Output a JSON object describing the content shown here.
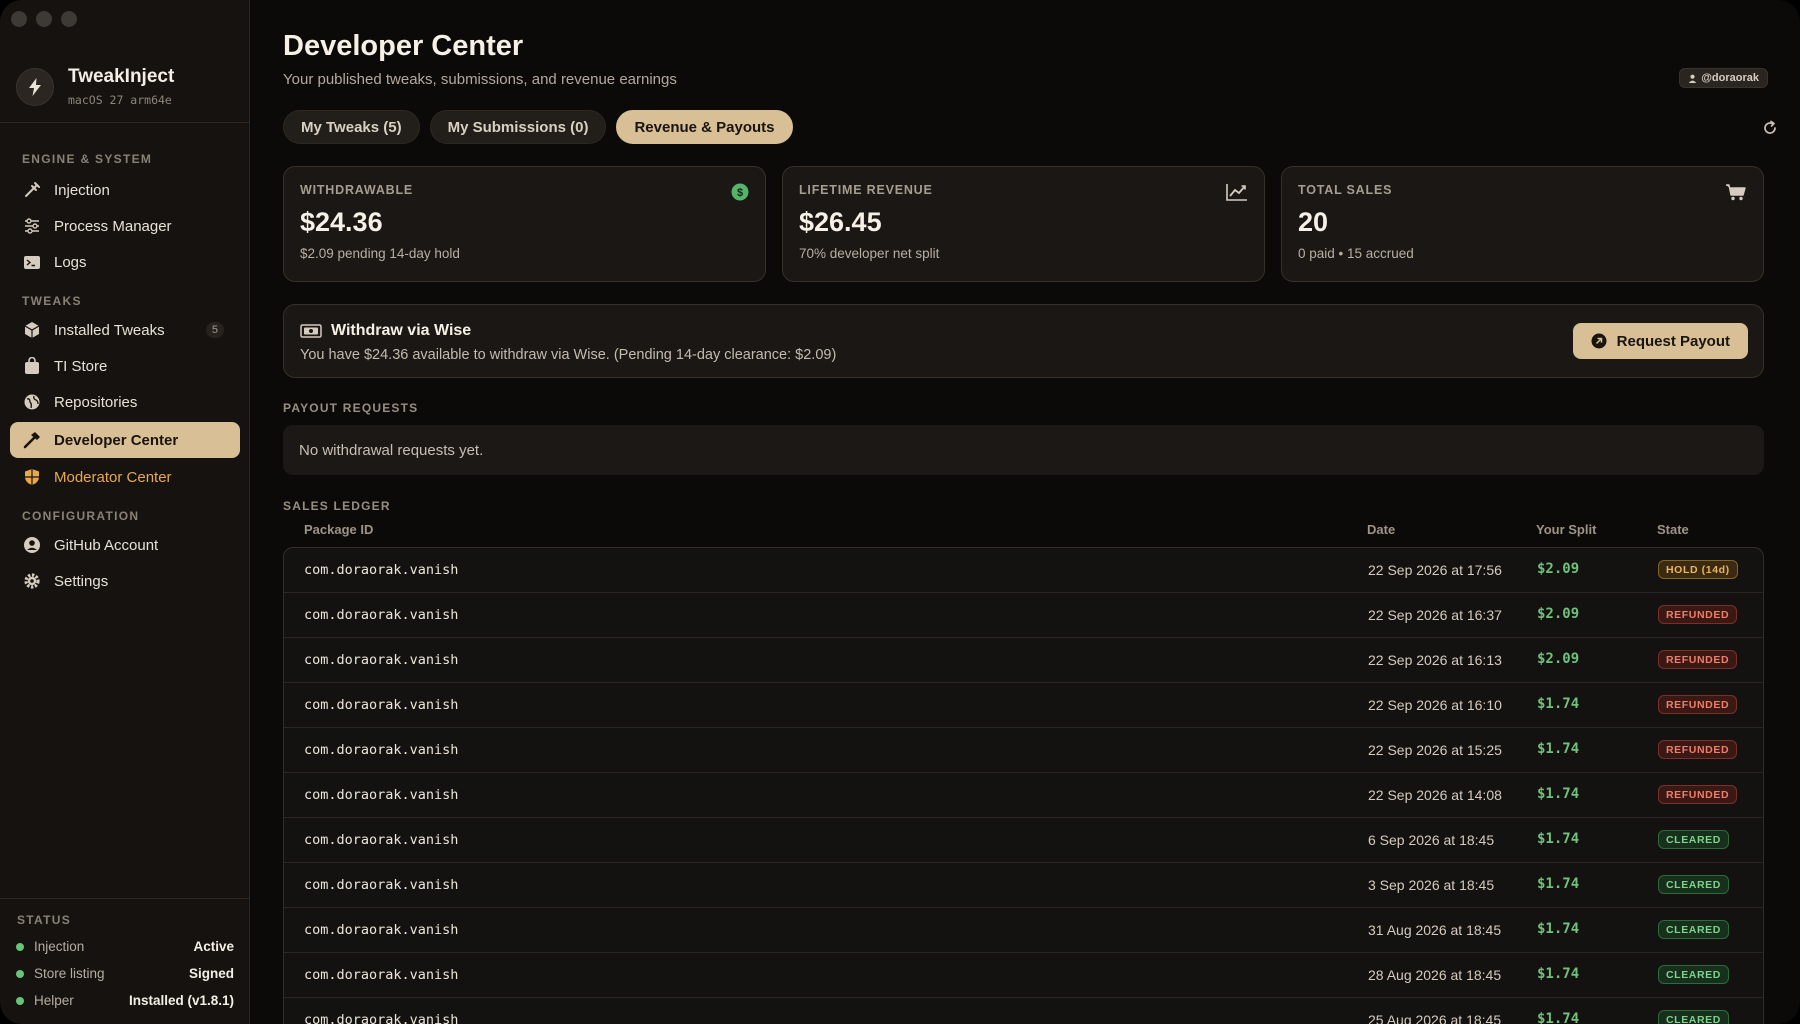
{
  "brand": {
    "name": "TweakInject",
    "subtitle": "macOS 27 arm64e"
  },
  "sidebar": {
    "sections": {
      "engine": "ENGINE & SYSTEM",
      "tweaks": "TWEAKS",
      "configuration": "CONFIGURATION",
      "status": "STATUS"
    },
    "items": {
      "injection": "Injection",
      "process_manager": "Process Manager",
      "logs": "Logs",
      "installed_tweaks": "Installed Tweaks",
      "installed_tweaks_count": "5",
      "ti_store": "TI Store",
      "repositories": "Repositories",
      "developer_center": "Developer Center",
      "moderator_center": "Moderator Center",
      "github_account": "GitHub Account",
      "settings": "Settings"
    },
    "status": [
      {
        "key": "Injection",
        "value": "Active"
      },
      {
        "key": "Store listing",
        "value": "Signed"
      },
      {
        "key": "Helper",
        "value": "Installed (v1.8.1)"
      }
    ]
  },
  "header": {
    "title": "Developer Center",
    "subtitle": "Your published tweaks, submissions, and revenue earnings",
    "user": "@doraorak"
  },
  "tabs": [
    "My Tweaks (5)",
    "My Submissions (0)",
    "Revenue & Payouts"
  ],
  "cards": {
    "withdrawable": {
      "label": "WITHDRAWABLE",
      "value": "$24.36",
      "note": "$2.09 pending 14-day hold",
      "icon_glyph": "$"
    },
    "lifetime": {
      "label": "LIFETIME REVENUE",
      "value": "$26.45",
      "note": "70% developer net split"
    },
    "sales": {
      "label": "TOTAL SALES",
      "value": "20",
      "note": "0 paid • 15 accrued"
    }
  },
  "withdraw": {
    "title": "Withdraw via Wise",
    "text": "You have $24.36 available to withdraw via Wise. (Pending 14-day clearance: $2.09)",
    "button": "Request Payout"
  },
  "payouts": {
    "title": "PAYOUT REQUESTS",
    "empty": "No withdrawal requests yet."
  },
  "ledger": {
    "title": "SALES LEDGER",
    "columns": [
      "Package ID",
      "Date",
      "Your Split",
      "State"
    ],
    "rows": [
      {
        "pkg": "com.doraorak.vanish",
        "date": "22 Sep 2026 at 17:56",
        "split": "$2.09",
        "state": "HOLD (14d)",
        "kind": "hold"
      },
      {
        "pkg": "com.doraorak.vanish",
        "date": "22 Sep 2026 at 16:37",
        "split": "$2.09",
        "state": "REFUNDED",
        "kind": "refunded"
      },
      {
        "pkg": "com.doraorak.vanish",
        "date": "22 Sep 2026 at 16:13",
        "split": "$2.09",
        "state": "REFUNDED",
        "kind": "refunded"
      },
      {
        "pkg": "com.doraorak.vanish",
        "date": "22 Sep 2026 at 16:10",
        "split": "$1.74",
        "state": "REFUNDED",
        "kind": "refunded"
      },
      {
        "pkg": "com.doraorak.vanish",
        "date": "22 Sep 2026 at 15:25",
        "split": "$1.74",
        "state": "REFUNDED",
        "kind": "refunded"
      },
      {
        "pkg": "com.doraorak.vanish",
        "date": "22 Sep 2026 at 14:08",
        "split": "$1.74",
        "state": "REFUNDED",
        "kind": "refunded"
      },
      {
        "pkg": "com.doraorak.vanish",
        "date": "6 Sep 2026 at 18:45",
        "split": "$1.74",
        "state": "CLEARED",
        "kind": "cleared"
      },
      {
        "pkg": "com.doraorak.vanish",
        "date": "3 Sep 2026 at 18:45",
        "split": "$1.74",
        "state": "CLEARED",
        "kind": "cleared"
      },
      {
        "pkg": "com.doraorak.vanish",
        "date": "31 Aug 2026 at 18:45",
        "split": "$1.74",
        "state": "CLEARED",
        "kind": "cleared"
      },
      {
        "pkg": "com.doraorak.vanish",
        "date": "28 Aug 2026 at 18:45",
        "split": "$1.74",
        "state": "CLEARED",
        "kind": "cleared"
      },
      {
        "pkg": "com.doraorak.vanish",
        "date": "25 Aug 2026 at 18:45",
        "split": "$1.74",
        "state": "CLEARED",
        "kind": "cleared"
      }
    ]
  },
  "colors": {
    "accent": "#d8bf95",
    "success": "#6ec27c",
    "warning": "#efb45a",
    "danger": "#f07d6a",
    "background": "#0c0a08"
  },
  "icons": {
    "brand": "bolt-icon",
    "injection": "syringe-icon",
    "process_manager": "sliders-icon",
    "logs": "terminal-icon",
    "installed_tweaks": "package-icon",
    "ti_store": "bag-icon",
    "repositories": "globe-icon",
    "developer_center": "hammer-icon",
    "moderator_center": "shield-icon",
    "github_account": "person-circle-icon",
    "settings": "gear-icon",
    "refresh": "refresh-icon",
    "lifetime": "chart-icon",
    "sales": "cart-icon",
    "withdraw": "banknote-icon",
    "payout": "arrow-circle-icon"
  }
}
